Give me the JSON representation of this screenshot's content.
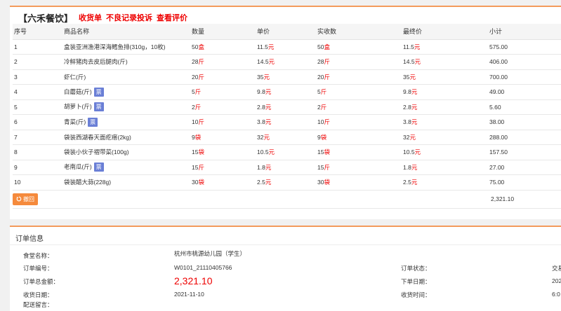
{
  "header": {
    "store_name": "【六禾餐饮】",
    "links": [
      "收货单",
      "不良记录投诉",
      "查看评价"
    ]
  },
  "table": {
    "columns": [
      "序号",
      "商品名称",
      "数量",
      "单价",
      "实收数",
      "最终价",
      "小计"
    ],
    "rows": [
      {
        "no": "1",
        "name": "盒装亚洲渔港深海鳕鱼排(310g，10枚)",
        "ticket": false,
        "qty": "50",
        "qty_unit": "盒",
        "price": "11.5",
        "price_unit": "元",
        "recv": "50",
        "recv_unit": "盒",
        "final": "11.5",
        "final_unit": "元",
        "subtotal": "575.00"
      },
      {
        "no": "2",
        "name": "冷鲜猪肉去皮后腿肉(斤)",
        "ticket": false,
        "qty": "28",
        "qty_unit": "斤",
        "price": "14.5",
        "price_unit": "元",
        "recv": "28",
        "recv_unit": "斤",
        "final": "14.5",
        "final_unit": "元",
        "subtotal": "406.00"
      },
      {
        "no": "3",
        "name": "虾仁(斤)",
        "ticket": false,
        "qty": "20",
        "qty_unit": "斤",
        "price": "35",
        "price_unit": "元",
        "recv": "20",
        "recv_unit": "斤",
        "final": "35",
        "final_unit": "元",
        "subtotal": "700.00"
      },
      {
        "no": "4",
        "name": "白蘑菇(斤)",
        "ticket": true,
        "qty": "5",
        "qty_unit": "斤",
        "price": "9.8",
        "price_unit": "元",
        "recv": "5",
        "recv_unit": "斤",
        "final": "9.8",
        "final_unit": "元",
        "subtotal": "49.00"
      },
      {
        "no": "5",
        "name": "胡萝卜(斤)",
        "ticket": true,
        "qty": "2",
        "qty_unit": "斤",
        "price": "2.8",
        "price_unit": "元",
        "recv": "2",
        "recv_unit": "斤",
        "final": "2.8",
        "final_unit": "元",
        "subtotal": "5.60"
      },
      {
        "no": "6",
        "name": "青菜(斤)",
        "ticket": true,
        "qty": "10",
        "qty_unit": "斤",
        "price": "3.8",
        "price_unit": "元",
        "recv": "10",
        "recv_unit": "斤",
        "final": "3.8",
        "final_unit": "元",
        "subtotal": "38.00"
      },
      {
        "no": "7",
        "name": "袋装西湖春天面疙瘩(2kg)",
        "ticket": false,
        "qty": "9",
        "qty_unit": "袋",
        "price": "32",
        "price_unit": "元",
        "recv": "9",
        "recv_unit": "袋",
        "final": "32",
        "final_unit": "元",
        "subtotal": "288.00"
      },
      {
        "no": "8",
        "name": "袋装小伙子褶带菜(100g)",
        "ticket": false,
        "qty": "15",
        "qty_unit": "袋",
        "price": "10.5",
        "price_unit": "元",
        "recv": "15",
        "recv_unit": "袋",
        "final": "10.5",
        "final_unit": "元",
        "subtotal": "157.50"
      },
      {
        "no": "9",
        "name": "老南瓜(斤)",
        "ticket": true,
        "qty": "15",
        "qty_unit": "斤",
        "price": "1.8",
        "price_unit": "元",
        "recv": "15",
        "recv_unit": "斤",
        "final": "1.8",
        "final_unit": "元",
        "subtotal": "27.00"
      },
      {
        "no": "10",
        "name": "袋装醋大蒜(228g)",
        "ticket": false,
        "qty": "30",
        "qty_unit": "袋",
        "price": "2.5",
        "price_unit": "元",
        "recv": "30",
        "recv_unit": "袋",
        "final": "2.5",
        "final_unit": "元",
        "subtotal": "75.00"
      }
    ],
    "ticket_label": "票",
    "back_label": "撤回",
    "total": "2,321.10"
  },
  "order": {
    "section_title": "订单信息",
    "canteen_label": "食堂名称：",
    "canteen_value": "杭州市桃源幼儿园（学生）",
    "order_no_label": "订单编号：",
    "order_no_value": "W0101_21110405766",
    "amount_label": "订单总金额：",
    "amount_value": "2,321.10",
    "receive_date_label": "收货日期：",
    "receive_date_value": "2021-11-10",
    "note_label": "配送留言：",
    "status_label": "订单状态：",
    "status_value": "交易",
    "order_date_label": "下单日期：",
    "order_date_value": "202",
    "receive_time_label": "收货时间：",
    "receive_time_value": "6:0"
  },
  "colors": {
    "accent": "#f39a5b",
    "price_red": "#e00",
    "ticket_blue": "#6a7fd6",
    "button_orange": "#f58a3c"
  }
}
